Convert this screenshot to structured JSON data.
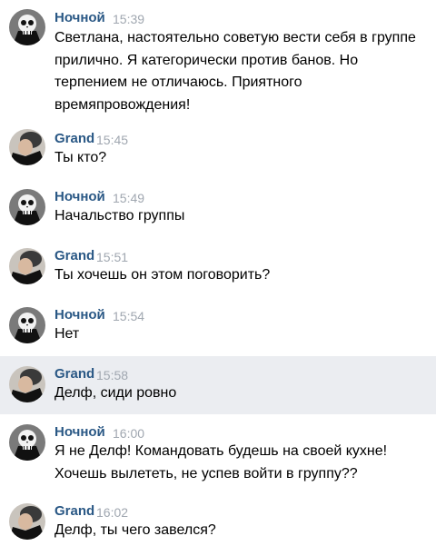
{
  "messages": [
    {
      "author": "Ночной",
      "time": "15:39",
      "lines": [
        "Светлана, настоятельно советую вести себя в группе",
        "прилично. Я категорически против банов. Но",
        "терпением не отличаюсь. Приятного",
        "времяпровождения!"
      ]
    },
    {
      "author": "Grand",
      "time": "15:45",
      "lines": [
        "Ты кто?"
      ]
    },
    {
      "author": "Ночной",
      "time": "15:49",
      "lines": [
        "Начальство группы"
      ]
    },
    {
      "author": "Grand",
      "time": "15:51",
      "lines": [
        "Ты хочешь он этом поговорить?"
      ]
    },
    {
      "author": "Ночной",
      "time": "15:54",
      "lines": [
        "Нет"
      ]
    },
    {
      "author": "Grand",
      "time": "15:58",
      "lines": [
        "Делф, сиди ровно"
      ],
      "highlighted": true
    },
    {
      "author": "Ночной",
      "time": "16:00",
      "lines": [
        "Я не Делф! Командовать будешь на своей кухне!",
        "Хочешь вылететь, не успев войти в группу??"
      ]
    },
    {
      "author": "Grand",
      "time": "16:02",
      "lines": [
        "Делф, ты чего завелся?"
      ]
    }
  ],
  "icons": {
    "nochnoy_avatar": "skull-avatar-icon",
    "grand_avatar": "profile-photo-avatar-icon"
  },
  "colors": {
    "author_name": "#2a5885",
    "timestamp": "#a0a7b0",
    "highlight_bg": "#ebedf1"
  }
}
